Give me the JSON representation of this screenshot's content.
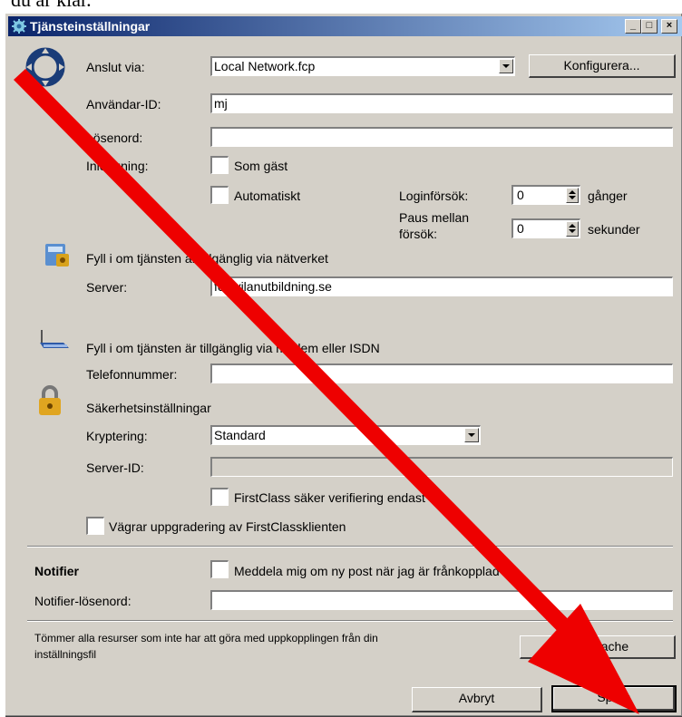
{
  "header_text": "du är klar.",
  "window": {
    "title": "Tjänsteinställningar",
    "controls": {
      "minimize": "_",
      "maximize": "□",
      "close": "×"
    }
  },
  "connection": {
    "connect_via_label": "Anslut via:",
    "connect_via_value": "Local Network.fcp",
    "configure_button": "Konfigurera...",
    "user_id_label": "Användar-ID:",
    "user_id_value": "mj",
    "password_label": "Lösenord:",
    "password_value": "",
    "login_label": "Inloggning:",
    "guest_checkbox": "Som gäst",
    "guest_checked": false,
    "auto_checkbox": "Automatiskt",
    "auto_checked": false,
    "login_attempts_label": "Loginförsök:",
    "login_attempts_value": "0",
    "login_attempts_unit": "gånger",
    "pause_label_line1": "Paus mellan",
    "pause_label_line2": "försök:",
    "pause_value": "0",
    "pause_unit": "sekunder"
  },
  "network": {
    "heading": "Fyll i om tjänsten är tillgänglig via nätverket",
    "server_label": "Server:",
    "server_value": "fc.hvilanutbildning.se"
  },
  "modem": {
    "heading": "Fyll i om tjänsten är tillgänglig via modem eller ISDN",
    "phone_label": "Telefonnummer:",
    "phone_value": ""
  },
  "security": {
    "heading": "Säkerhetsinställningar",
    "encryption_label": "Kryptering:",
    "encryption_value": "Standard",
    "server_id_label": "Server-ID:",
    "server_id_value": "",
    "secure_verify_checkbox": "FirstClass säker verifiering endast",
    "refuse_upgrade_checkbox": "Vägrar uppgradering av FirstClassklienten"
  },
  "notifier": {
    "heading": "Notifier",
    "notify_checkbox": "Meddela mig om ny post när jag är frånkopplad",
    "password_label": "Notifier-lösenord:",
    "password_value": ""
  },
  "cache": {
    "description_line1": "Tömmer alla resurser som inte har att göra med uppkopplingen från din",
    "description_line2": "inställningsfil",
    "clear_button": "Töm cache"
  },
  "footer": {
    "cancel_button": "Avbryt",
    "save_button": "Spara"
  },
  "colors": {
    "arrow": "#ee0000",
    "titlebar_start": "#0a246a",
    "dialog_bg": "#d4d0c8"
  },
  "icons": [
    "firstclass-ring-icon",
    "gear-icon",
    "network-server-icon",
    "modem-icon",
    "lock-icon"
  ]
}
